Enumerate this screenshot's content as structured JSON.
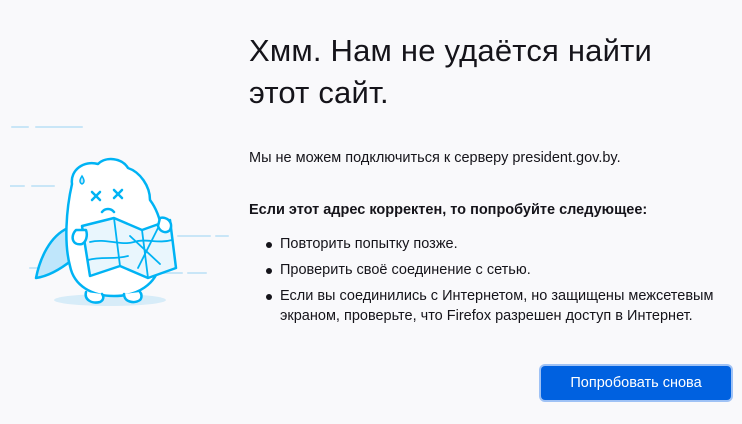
{
  "error": {
    "title": "Хмм. Нам не удаётся найти этот сайт.",
    "intro": "Мы не можем подключиться к серверу president.gov.by.",
    "suggest_heading": "Если этот адрес корректен, то попробуйте следующее:",
    "suggestions": [
      "Повторить попытку позже.",
      "Проверить своё соединение с сетью.",
      "Если вы соединились с Интернетом, но защищены межсетевым экраном, проверьте, что Firefox разрешен доступ в Интернет."
    ],
    "retry_label": "Попробовать снова"
  },
  "illustration": {
    "icon": "lost-map-character-icon"
  },
  "colors": {
    "background": "#f9f9fb",
    "text": "#15141a",
    "accent": "#0061e0",
    "illustration_line": "#00b3f4"
  }
}
